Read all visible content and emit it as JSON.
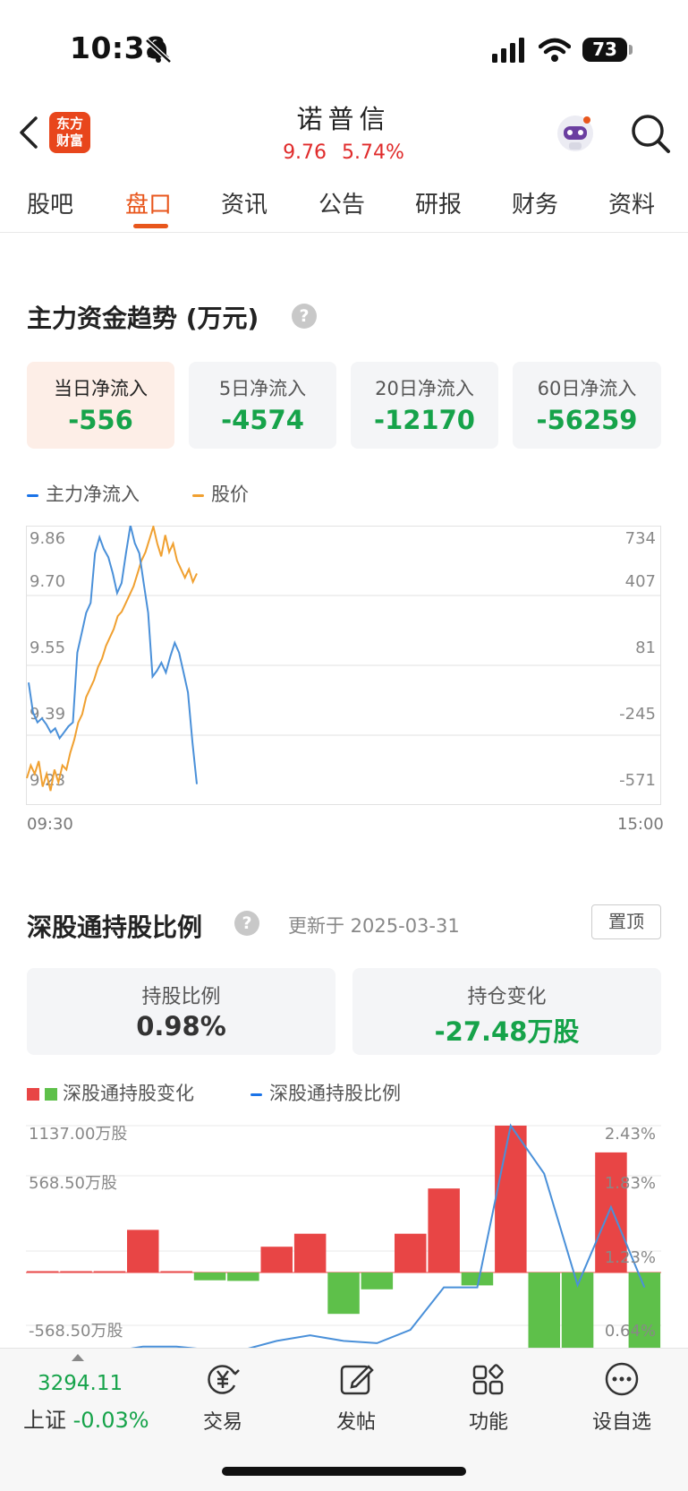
{
  "status_bar": {
    "time": "10:38",
    "battery": "73"
  },
  "header": {
    "logo_text": "东方财富",
    "stock_name": "诺普信",
    "price": "9.76",
    "change_pct": "5.74%"
  },
  "tabs": [
    "股吧",
    "盘口",
    "资讯",
    "公告",
    "研报",
    "财务",
    "资料"
  ],
  "active_tab": "盘口",
  "fund_trend": {
    "title": "主力资金趋势 (万元)",
    "help": "?",
    "cards": [
      {
        "label": "当日净流入",
        "value": "-556"
      },
      {
        "label": "5日净流入",
        "value": "-4574"
      },
      {
        "label": "20日净流入",
        "value": "-12170"
      },
      {
        "label": "60日净流入",
        "value": "-56259"
      }
    ],
    "legend": {
      "main_inflow": "主力净流入",
      "price": "股价"
    },
    "colors": {
      "main_inflow": "#4a90d9",
      "price": "#f0a030",
      "negative": "#16a34a"
    }
  },
  "sz_connect": {
    "title": "深股通持股比例",
    "help": "?",
    "updated": "更新于 2025-03-31",
    "pin": "置顶",
    "ratio_label": "持股比例",
    "ratio_value": "0.98%",
    "change_label": "持仓变化",
    "change_value": "-27.48万股",
    "legend_bar": "深股通持股变化",
    "legend_line": "深股通持股比例",
    "colors": {
      "up": "#e84545",
      "down": "#5ec04a",
      "line": "#4a90d9"
    }
  },
  "chart_data": [
    {
      "type": "line",
      "title": "",
      "x_start_label": "09:30",
      "x_end_label": "15:00",
      "left_axis_ticks": [
        "9.86",
        "9.70",
        "9.55",
        "9.39",
        "9.23"
      ],
      "right_axis_ticks": [
        "734",
        "407",
        "81",
        "-245",
        "-571"
      ],
      "series": [
        {
          "name": "股价",
          "axis": "left",
          "values": [
            9.27,
            9.3,
            9.28,
            9.31,
            9.25,
            9.28,
            9.24,
            9.29,
            9.26,
            9.3,
            9.29,
            9.33,
            9.36,
            9.4,
            9.42,
            9.46,
            9.48,
            9.5,
            9.53,
            9.55,
            9.58,
            9.6,
            9.62,
            9.65,
            9.66,
            9.68,
            9.7,
            9.72,
            9.75,
            9.78,
            9.8,
            9.83,
            9.86,
            9.82,
            9.79,
            9.84,
            9.8,
            9.82,
            9.78,
            9.76,
            9.74,
            9.76,
            9.73,
            9.75
          ]
        },
        {
          "name": "主力净流入",
          "axis": "right",
          "values": [
            -50,
            -200,
            -250,
            -230,
            -260,
            -300,
            -280,
            -330,
            -300,
            -270,
            -250,
            100,
            200,
            300,
            350,
            600,
            680,
            620,
            580,
            500,
            400,
            450,
            600,
            740,
            650,
            600,
            450,
            300,
            -20,
            10,
            50,
            0,
            80,
            150,
            100,
            0,
            -100,
            -350,
            -560
          ]
        }
      ]
    },
    {
      "type": "bar",
      "title": "",
      "left_axis_ticks": [
        "1137.00万股",
        "568.50万股",
        "-568.50万股"
      ],
      "right_axis_ticks": [
        "2.43%",
        "1.83%",
        "1.23%",
        "0.64%"
      ],
      "series": [
        {
          "name": "深股通持股变化",
          "values": [
            2,
            1,
            2,
            330,
            1,
            -60,
            -65,
            200,
            300,
            -320,
            -130,
            300,
            650,
            -100,
            1137,
            -680,
            -750,
            930,
            -780
          ]
        },
        {
          "name": "深股通持股比例",
          "values": [
            0.4,
            0.4,
            0.4,
            0.45,
            0.45,
            0.42,
            0.42,
            0.5,
            0.55,
            0.5,
            0.48,
            0.6,
            0.98,
            0.98,
            2.43,
            2.0,
            1.0,
            1.7,
            0.98
          ]
        }
      ]
    }
  ],
  "bottom_nav": {
    "index_value": "3294.11",
    "index_name": "上证",
    "index_change": "-0.03%",
    "items": [
      "交易",
      "发帖",
      "功能",
      "设自选"
    ]
  }
}
